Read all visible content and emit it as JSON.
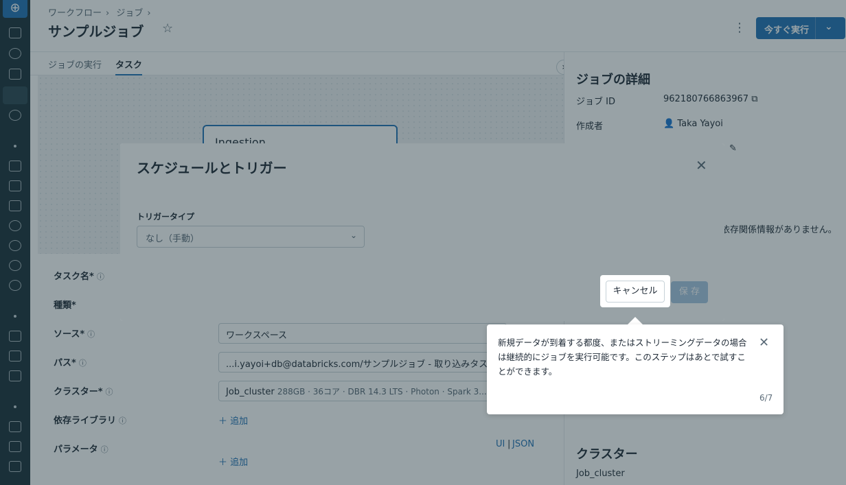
{
  "header": {
    "breadcrumb": [
      "ワークフロー",
      "ジョブ"
    ],
    "title": "サンプルジョブ",
    "run_button": "今すぐ実行"
  },
  "tabs": [
    {
      "label": "ジョブの実行",
      "active": false
    },
    {
      "label": "タスク",
      "active": true
    }
  ],
  "canvas": {
    "node_label": "Ingestion"
  },
  "task_form": {
    "task_name_label": "タスク名*",
    "type_label": "種類*",
    "source_label": "ソース*",
    "source_value": "ワークスペース",
    "path_label": "パス*",
    "path_value": "...i.yayoi+db@databricks.com/サンプルジョブ - 取り込みタスク",
    "cluster_label": "クラスター*",
    "cluster_name": "Job_cluster",
    "cluster_detail": "288GB · 36コア · DBR 14.3 LTS · Photon · Spark 3....",
    "libraries_label": "依存ライブラリ",
    "libraries_add": "追加",
    "params_label": "パラメータ",
    "params_ui": "UI",
    "params_sep": "|",
    "params_json": "JSON",
    "params_add": "追加"
  },
  "details_panel": {
    "title": "ジョブの詳細",
    "job_id_label": "ジョブ ID",
    "job_id": "962180766863967",
    "creator_label": "作成者",
    "creator": "Taka Yayoi",
    "deps_note": "依存関係情報がありません。",
    "cluster_title": "クラスター",
    "cluster_name": "Job_cluster"
  },
  "modal": {
    "title": "スケジュールとトリガー",
    "trigger_label": "トリガータイプ",
    "trigger_value": "なし（手動）",
    "cancel": "キャンセル",
    "save": "保 存"
  },
  "tour": {
    "text": "新規データが到着する都度、またはストリーミングデータの場合は継続的にジョブを実行可能です。このステップはあとで試すことができます。",
    "step": "6/7"
  },
  "colors": {
    "primary": "#2272b4",
    "rail": "#1b3139",
    "text": "#1f2a36",
    "muted": "#5a6a77"
  }
}
